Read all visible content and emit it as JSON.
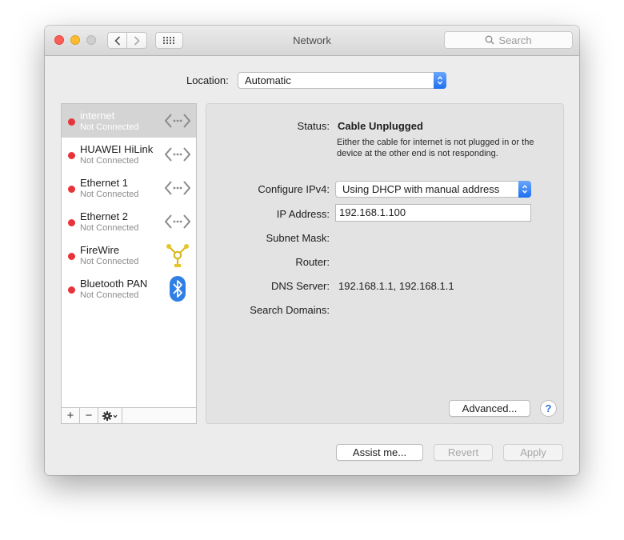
{
  "window": {
    "title": "Network"
  },
  "toolbar": {
    "search_placeholder": "Search",
    "back_icon": "chevron-left-icon",
    "forward_icon": "chevron-right-icon",
    "show_all_icon": "grid-icon"
  },
  "location": {
    "label": "Location:",
    "value": "Automatic"
  },
  "services": [
    {
      "name": "internet",
      "status": "Not Connected",
      "selected": true,
      "icon": "ethernet-arrows-icon",
      "status_color": "#e8333a"
    },
    {
      "name": "HUAWEI HiLink",
      "status": "Not Connected",
      "selected": false,
      "icon": "ethernet-arrows-icon",
      "status_color": "#e8333a"
    },
    {
      "name": "Ethernet 1",
      "status": "Not Connected",
      "selected": false,
      "icon": "ethernet-arrows-icon",
      "status_color": "#e8333a"
    },
    {
      "name": "Ethernet 2",
      "status": "Not Connected",
      "selected": false,
      "icon": "ethernet-arrows-icon",
      "status_color": "#e8333a"
    },
    {
      "name": "FireWire",
      "status": "Not Connected",
      "selected": false,
      "icon": "firewire-icon",
      "status_color": "#e8333a"
    },
    {
      "name": "Bluetooth PAN",
      "status": "Not Connected",
      "selected": false,
      "icon": "bluetooth-icon",
      "status_color": "#e8333a"
    }
  ],
  "sidebar_controls": {
    "add": "+",
    "remove": "−",
    "gear_icon": "gear-icon"
  },
  "detail": {
    "status_label": "Status:",
    "status_value": "Cable Unplugged",
    "status_description": "Either the cable for internet is not plugged in or the device at the other end is not responding.",
    "configure_label": "Configure IPv4:",
    "configure_value": "Using DHCP with manual address",
    "ip_label": "IP Address:",
    "ip_value": "192.168.1.100",
    "subnet_label": "Subnet Mask:",
    "subnet_value": "",
    "router_label": "Router:",
    "router_value": "",
    "dns_label": "DNS Server:",
    "dns_value": "192.168.1.1, 192.168.1.1",
    "search_domains_label": "Search Domains:",
    "search_domains_value": "",
    "advanced_label": "Advanced...",
    "help_label": "?"
  },
  "footer": {
    "assist_label": "Assist me...",
    "revert_label": "Revert",
    "apply_label": "Apply"
  },
  "colors": {
    "accent": "#1e6ff1",
    "disconnected": "#e8333a"
  }
}
